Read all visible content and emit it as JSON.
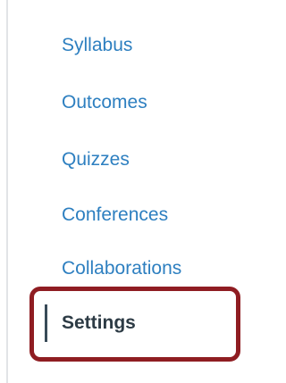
{
  "course_nav": {
    "items": [
      {
        "label": "Syllabus"
      },
      {
        "label": "Outcomes"
      },
      {
        "label": "Quizzes"
      },
      {
        "label": "Conferences"
      },
      {
        "label": "Collaborations"
      },
      {
        "label": "Settings",
        "active": true
      }
    ],
    "colors": {
      "link": "#2d7fc0",
      "active_text": "#2d3b45",
      "active_indicator": "#394b58",
      "highlight_outline": "#8f1d22",
      "divider": "#e2e4e7"
    }
  }
}
